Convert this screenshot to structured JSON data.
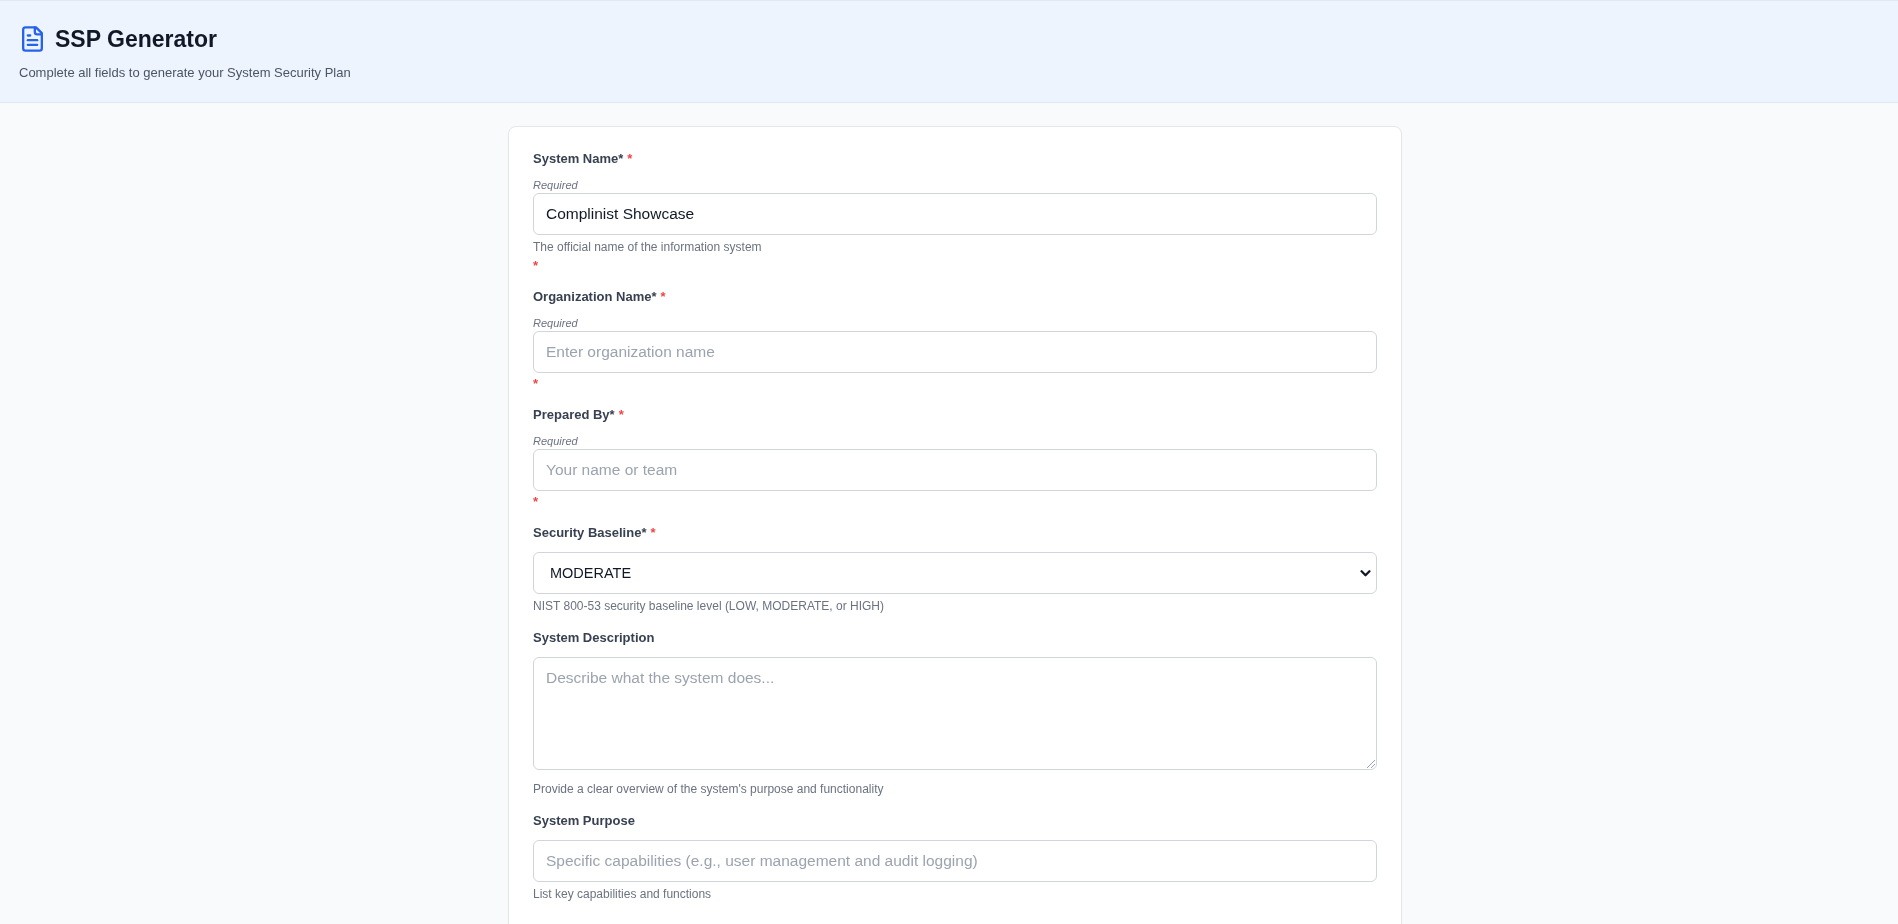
{
  "header": {
    "title": "SSP Generator",
    "subtitle": "Complete all fields to generate your System Security Plan"
  },
  "fields": [
    {
      "kind": "text",
      "label": "System Name*",
      "required_mark": "*",
      "note": "Required",
      "value": "Complinist Showcase",
      "help": "The official name of the information system",
      "error_mark": "*"
    },
    {
      "kind": "text",
      "label": "Organization Name*",
      "required_mark": "*",
      "note": "Required",
      "placeholder": "Enter organization name",
      "error_mark": "*"
    },
    {
      "kind": "text",
      "label": "Prepared By*",
      "required_mark": "*",
      "note": "Required",
      "placeholder": "Your name or team",
      "error_mark": "*"
    },
    {
      "kind": "select",
      "label": "Security Baseline*",
      "required_mark": "*",
      "value": "MODERATE",
      "help": "NIST 800-53 security baseline level (LOW, MODERATE, or HIGH)"
    },
    {
      "kind": "textarea",
      "label": "System Description",
      "placeholder": "Describe what the system does...",
      "help": "Provide a clear overview of the system's purpose and functionality"
    },
    {
      "kind": "text",
      "label": "System Purpose",
      "placeholder": "Specific capabilities (e.g., user management and audit logging)",
      "help": "List key capabilities and functions"
    }
  ]
}
